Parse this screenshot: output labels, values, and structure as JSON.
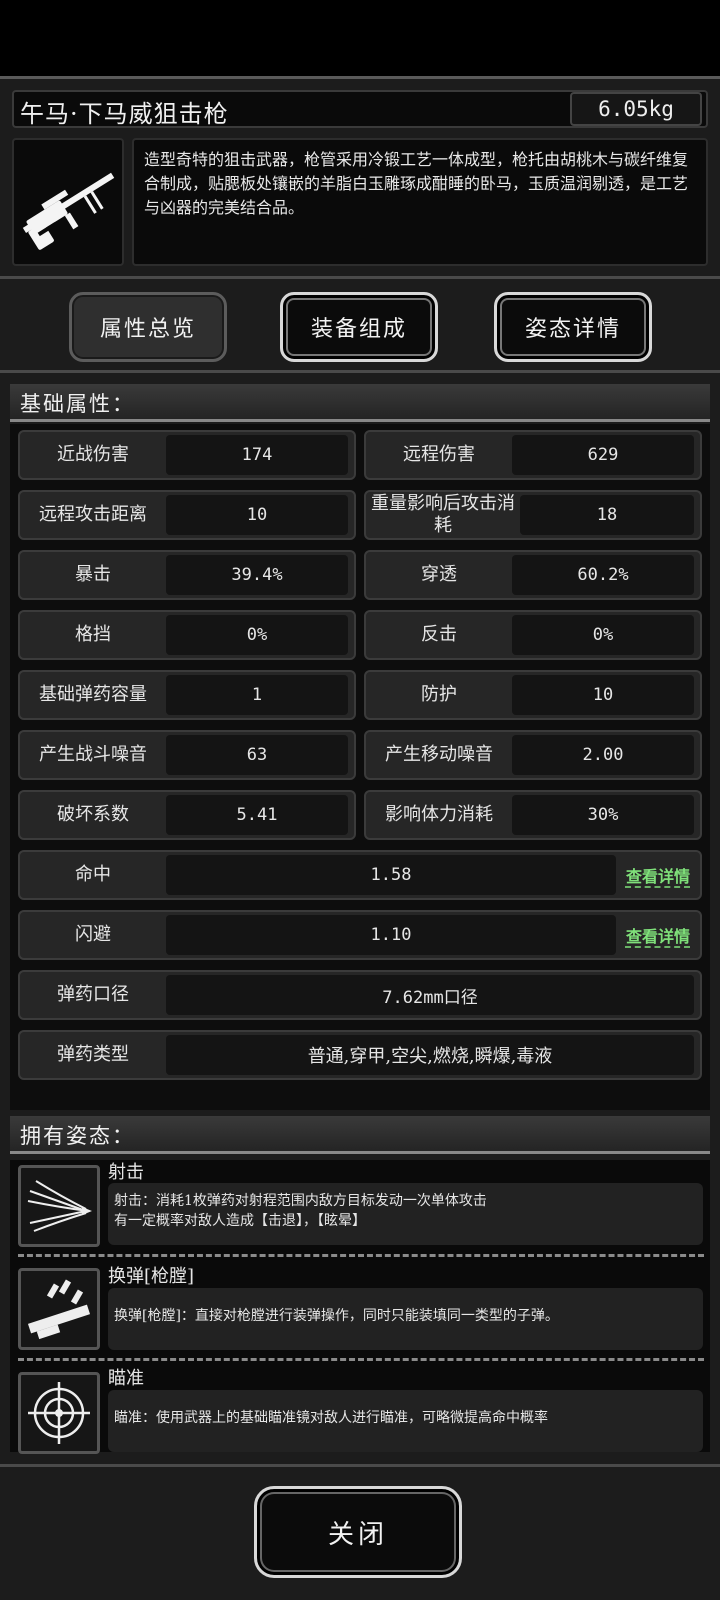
{
  "weapon": {
    "name": "午马·下马威狙击枪",
    "weight": "6.05kg",
    "description": "造型奇特的狙击武器，枪管采用冷锻工艺一体成型，枪托由胡桃木与碳纤维复合制成，贴腮板处镶嵌的羊脂白玉雕琢成酣睡的卧马，玉质温润剔透，是工艺与凶器的完美结合品。"
  },
  "tabs": [
    {
      "label": "属性总览",
      "active": true
    },
    {
      "label": "装备组成",
      "active": false
    },
    {
      "label": "姿态详情",
      "active": false
    }
  ],
  "attributes": {
    "header": "基础属性：",
    "pairs": [
      [
        {
          "label": "近战伤害",
          "value": "174"
        },
        {
          "label": "远程伤害",
          "value": "629"
        }
      ],
      [
        {
          "label": "远程攻击距离",
          "value": "10"
        },
        {
          "label": "重量影响后攻击消耗",
          "value": "18"
        }
      ],
      [
        {
          "label": "暴击",
          "value": "39.4%"
        },
        {
          "label": "穿透",
          "value": "60.2%"
        }
      ],
      [
        {
          "label": "格挡",
          "value": "0%"
        },
        {
          "label": "反击",
          "value": "0%"
        }
      ],
      [
        {
          "label": "基础弹药容量",
          "value": "1"
        },
        {
          "label": "防护",
          "value": "10"
        }
      ],
      [
        {
          "label": "产生战斗噪音",
          "value": "63"
        },
        {
          "label": "产生移动噪音",
          "value": "2.00"
        }
      ],
      [
        {
          "label": "破坏系数",
          "value": "5.41"
        },
        {
          "label": "影响体力消耗",
          "value": "30%"
        }
      ]
    ],
    "full": [
      {
        "label": "命中",
        "value": "1.58",
        "link": "查看详情"
      },
      {
        "label": "闪避",
        "value": "1.10",
        "link": "查看详情"
      },
      {
        "label": "弹药口径",
        "value": "7.62mm口径"
      },
      {
        "label": "弹药类型",
        "value": "普通,穿甲,空尖,燃烧,瞬爆,毒液"
      }
    ]
  },
  "stances": {
    "header": "拥有姿态：",
    "items": [
      {
        "name": "射击",
        "icon": "shoot-icon",
        "desc_line1": "射击：消耗1枚弹药对射程范围内敌方目标发动一次单体攻击",
        "desc_line2": "有一定概率对敌人造成【击退】，【眩晕】"
      },
      {
        "name": "换弹[枪膛]",
        "icon": "reload-icon",
        "desc_line1": "换弹[枪膛]：直接对枪膛进行装弹操作，同时只能装填同一类型的子弹。",
        "desc_line2": ""
      },
      {
        "name": "瞄准",
        "icon": "crosshair-icon",
        "desc_line1": "瞄准：使用武器上的基础瞄准镜对敌人进行瞄准，可略微提高命中概率",
        "desc_line2": ""
      }
    ]
  },
  "close_label": "关闭",
  "colors": {
    "link": "#7fe07a",
    "background": "#1c1c1c"
  }
}
